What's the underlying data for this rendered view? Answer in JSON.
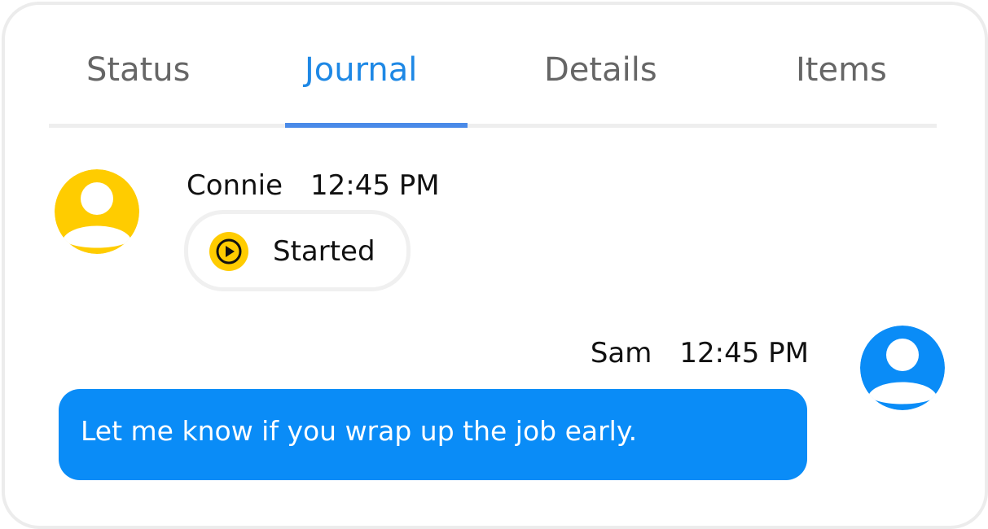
{
  "tabs": [
    {
      "label": "Status",
      "active": false
    },
    {
      "label": "Journal",
      "active": true
    },
    {
      "label": "Details",
      "active": false
    },
    {
      "label": "Items",
      "active": false
    }
  ],
  "colors": {
    "accent": "#1e88e5",
    "tab_inactive": "#666666",
    "avatar_connie": "#ffcc00",
    "avatar_sam": "#0a8cf7",
    "bubble": "#0a8cf7"
  },
  "journal": {
    "entries": [
      {
        "author": "Connie",
        "time": "12:45 PM",
        "avatar_icon": "user-avatar-icon",
        "status": {
          "icon": "play-circle-icon",
          "label": "Started"
        }
      },
      {
        "author": "Sam",
        "time": "12:45 PM",
        "avatar_icon": "user-avatar-icon",
        "message": "Let me know if you wrap up the job early."
      }
    ]
  }
}
